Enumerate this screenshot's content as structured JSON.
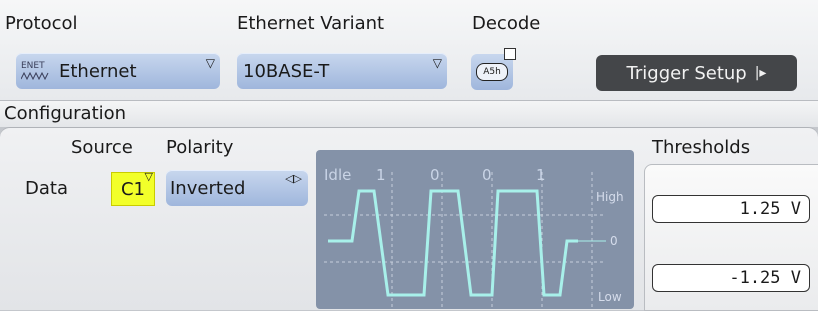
{
  "protocol": {
    "label": "Protocol",
    "value": "Ethernet",
    "icon_text": "ENET"
  },
  "variant": {
    "label": "Ethernet Variant",
    "value": "10BASE-T"
  },
  "decode": {
    "label": "Decode",
    "icon_text": "A5h"
  },
  "trigger_setup": {
    "label": "Trigger Setup",
    "arrow": "|▸"
  },
  "configuration": {
    "title": "Configuration"
  },
  "source": {
    "header": "Source",
    "row_label": "Data",
    "value": "C1"
  },
  "polarity": {
    "header": "Polarity",
    "value": "Inverted"
  },
  "thresholds": {
    "header": "Thresholds",
    "high": "1.25 V",
    "low": "-1.25 V"
  },
  "graph": {
    "bit_labels": [
      "Idle",
      "1",
      "0",
      "0",
      "1"
    ],
    "level_high": "High",
    "level_zero": "0",
    "level_low": "Low",
    "trace_color": "#a8f0ea"
  }
}
